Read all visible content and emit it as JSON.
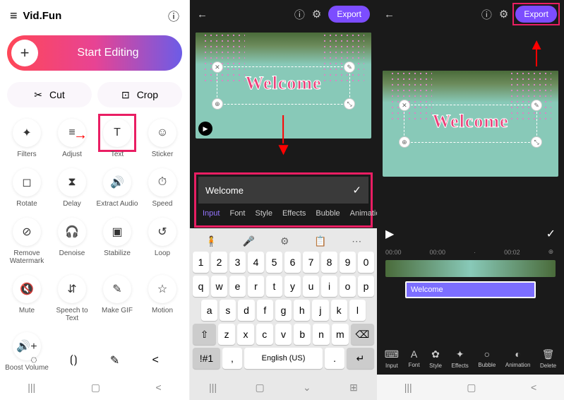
{
  "panel1": {
    "app_name": "Vid.Fun",
    "start_label": "Start Editing",
    "cut_label": "Cut",
    "crop_label": "Crop",
    "tools": [
      {
        "icon": "✦",
        "label": "Filters"
      },
      {
        "icon": "≡",
        "label": "Adjust"
      },
      {
        "icon": "T",
        "label": "Text",
        "highlight": true,
        "arrow": true
      },
      {
        "icon": "☺",
        "label": "Sticker"
      },
      {
        "icon": "◻",
        "label": "Rotate"
      },
      {
        "icon": "⧗",
        "label": "Delay"
      },
      {
        "icon": "🔊",
        "label": "Extract Audio"
      },
      {
        "icon": "⏱",
        "label": "Speed"
      },
      {
        "icon": "⊘",
        "label": "Remove Watermark"
      },
      {
        "icon": "🎧",
        "label": "Denoise"
      },
      {
        "icon": "▣",
        "label": "Stabilize"
      },
      {
        "icon": "↺",
        "label": "Loop"
      },
      {
        "icon": "🔇",
        "label": "Mute"
      },
      {
        "icon": "⇵",
        "label": "Speech to Text"
      },
      {
        "icon": "✎",
        "label": "Make GIF"
      },
      {
        "icon": "☆",
        "label": "Motion"
      },
      {
        "icon": "🔊+",
        "label": "Boost Volume"
      }
    ]
  },
  "panel2": {
    "export_label": "Export",
    "preview_text": "Welcome",
    "input_value": "Welcome",
    "tabs": [
      "Input",
      "Font",
      "Style",
      "Effects",
      "Bubble",
      "Animation"
    ],
    "keyboard": {
      "numbers": [
        "1",
        "2",
        "3",
        "4",
        "5",
        "6",
        "7",
        "8",
        "9",
        "0"
      ],
      "row1": [
        "q",
        "w",
        "e",
        "r",
        "t",
        "y",
        "u",
        "i",
        "o",
        "p"
      ],
      "row2": [
        "a",
        "s",
        "d",
        "f",
        "g",
        "h",
        "j",
        "k",
        "l"
      ],
      "row3": [
        "z",
        "x",
        "c",
        "v",
        "b",
        "n",
        "m"
      ],
      "shift": "⇧",
      "back": "⌫",
      "sym": "!#1",
      "lang": "English (US)",
      "period": ".",
      "enter": "↵"
    }
  },
  "panel3": {
    "export_label": "Export",
    "preview_text": "Welcome",
    "time_start": "00:00",
    "time_a": "00:00",
    "time_b": "00:02",
    "clip_label": "Welcome",
    "tools": [
      {
        "icon": "⌨",
        "label": "Input"
      },
      {
        "icon": "A",
        "label": "Font"
      },
      {
        "icon": "✿",
        "label": "Style"
      },
      {
        "icon": "✦",
        "label": "Effects"
      },
      {
        "icon": "○",
        "label": "Bubble"
      },
      {
        "icon": "◐",
        "label": "Animation"
      },
      {
        "icon": "🗑",
        "label": "Delete"
      }
    ]
  }
}
